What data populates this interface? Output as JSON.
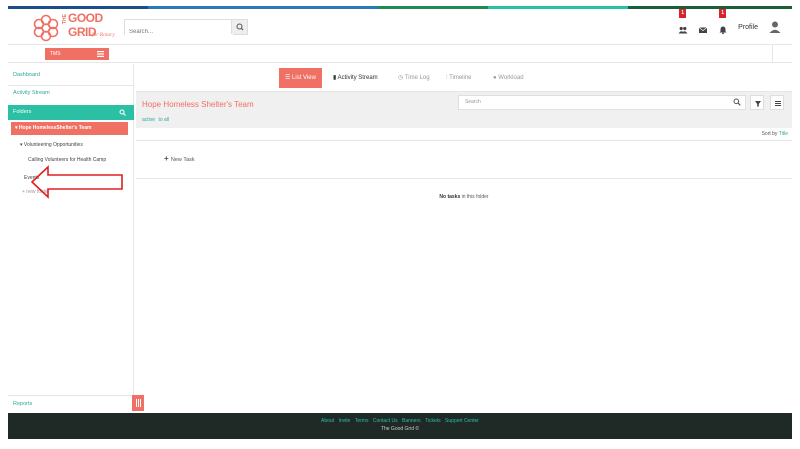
{
  "brand": {
    "logo_line1": "THE",
    "logo_line2": "GOOD",
    "logo_line3": "GRID",
    "logo_tagline": "for Rotary",
    "colors": {
      "teal": "#2bbfa4",
      "coral": "#f07063",
      "footer": "#1f2a26",
      "badge": "#d9232b"
    },
    "stripe_colors": [
      "#1a4f8a",
      "#2a7ab8",
      "#1f8a54",
      "#2bbfa4",
      "#1a5f3a"
    ]
  },
  "header": {
    "search_placeholder": "Search...",
    "icons": [
      "users-icon",
      "mail-icon",
      "bell-icon"
    ],
    "users_badge": "1",
    "bell_badge": "1",
    "profile_label": "Profile"
  },
  "subheader": {
    "module_label": "TMS"
  },
  "sidebar": {
    "dashboard": "Dashboard",
    "activity_stream": "Activity Stream",
    "folders": "Folders",
    "team": "Hope HomelessShelter's Team",
    "tree": {
      "parent": "Volunteering Opportunities",
      "child": "Calling Volunteers for Health Camp",
      "events": "Events",
      "new_folder": "+ new folder"
    },
    "reports": "Reports"
  },
  "tabs": [
    {
      "label": "List View",
      "icon": "list-icon",
      "active": true
    },
    {
      "label": "Activity Stream",
      "icon": "comment-icon"
    },
    {
      "label": "Time Log",
      "icon": "clock-icon"
    },
    {
      "label": "Timeline",
      "icon": "timeline-icon"
    },
    {
      "label": "Workload",
      "icon": "user-icon"
    }
  ],
  "main": {
    "team_title": "Hope Homeless Shelter's Team",
    "search_placeholder": "Search",
    "filter_active": "active",
    "filter_all": "to all",
    "sort_by_label": "Sort by",
    "sort_by_value": "Title",
    "new_task": "New Task",
    "no_tasks_bold": "No tasks",
    "no_tasks_rest": "in this folder"
  },
  "footer": {
    "links": [
      "About",
      "Invite",
      "Terms",
      "Contact Us",
      "Banners",
      "Tickets",
      "Support Center"
    ],
    "copyright": "The Good Grid ©"
  }
}
